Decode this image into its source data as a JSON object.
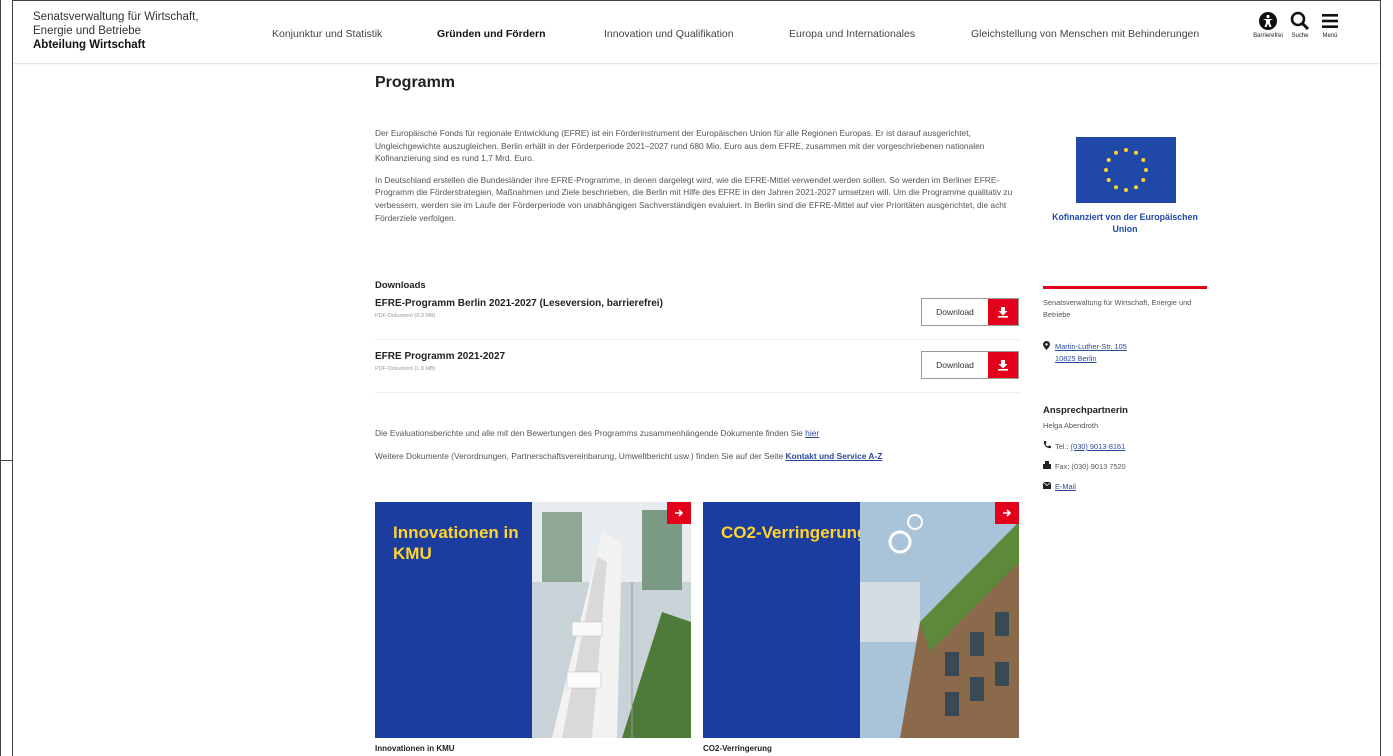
{
  "header": {
    "org_line1": "Senatsverwaltung für Wirtschaft,",
    "org_line2": "Energie und Betriebe",
    "department": "Abteilung Wirtschaft",
    "nav": [
      {
        "label": "Konjunktur und Statistik",
        "active": false
      },
      {
        "label": "Gründen und Fördern",
        "active": true
      },
      {
        "label": "Innovation und Qualifikation",
        "active": false
      },
      {
        "label": "Europa und Internationales",
        "active": false
      },
      {
        "label": "Gleichstellung von Menschen mit Behinderungen",
        "active": false
      }
    ],
    "tools": [
      {
        "label": "Barrierefrei",
        "icon": "accessibility-icon"
      },
      {
        "label": "Suche",
        "icon": "search-icon"
      },
      {
        "label": "Menü",
        "icon": "menu-icon"
      }
    ]
  },
  "main": {
    "title": "Programm",
    "intro_p1": "Der Europäische Fonds für regionale Entwicklung (EFRE) ist ein Förderinstrument der Europäischen Union für alle Regionen Europas. Er ist darauf ausgerichtet, Ungleichgewichte auszugleichen. Berlin erhält in der Förderperiode 2021–2027 rund 680 Mio. Euro aus dem EFRE, zusammen mit der vorgeschriebenen nationalen Kofinanzierung sind es rund 1,7 Mrd. Euro.",
    "intro_p2": "In Deutschland erstellen die Bundesländer ihre EFRE-Programme, in denen dargelegt wird, wie die EFRE-Mittel verwendet werden sollen. So werden im Berliner EFRE-Programm die Förderstrategien, Maßnahmen und Ziele beschrieben, die Berlin mit Hilfe des EFRE in den Jahren 2021-2027 umsetzen will. Um die Programme qualitativ zu verbessern, werden sie im Laufe der Förderperiode von unabhängigen Sachverständigen evaluiert. In Berlin sind die EFRE-Mittel auf vier Prioritäten ausgerichtet, die acht Förderziele verfolgen.",
    "downloads_title": "Downloads",
    "downloads": [
      {
        "name": "EFRE-Programm Berlin 2021-2027 (Leseversion, barrierefrei)",
        "meta": "PDF-Dokument (8,9 MB)",
        "button": "Download"
      },
      {
        "name": "EFRE Programm 2021-2027",
        "meta": "PDF-Dokument (1,9 MB)",
        "button": "Download"
      }
    ],
    "eval_text": "Die Evaluationsberichte und alle mit den Bewertungen des Programms zusammenhängende Dokumente finden Sie ",
    "eval_link": "hier",
    "more_text": "Weitere Dokumente (Verordnungen, Partnerschaftsvereinbarung, Umweltbericht usw.) finden Sie auf der Seite ",
    "more_link": "Kontakt und Service A-Z",
    "tiles": [
      {
        "text": "Innovationen in KMU",
        "caption": "Innovationen in KMU"
      },
      {
        "text": "CO2-Verringerung",
        "caption": "CO2-Verringerung"
      }
    ]
  },
  "sidebar": {
    "eu_label": "Kofinanziert von der Europäischen Union",
    "org": "Senatsverwaltung für Wirtschaft, Energie und Betriebe",
    "address_line1": "Martin-Luther-Str. 105",
    "address_line2": "10825 Berlin",
    "contact_title": "Ansprechpartnerin",
    "contact_name": "Helga Abendroth",
    "tel_label": "Tel.:",
    "tel": "(030) 9013-8161",
    "fax": "Fax: (030) 9013 7520",
    "email": "E-Mail"
  },
  "colors": {
    "accent_red": "#e2001a",
    "eu_blue": "#1f48a8",
    "tile_blue": "#1c3da0",
    "tile_yellow": "#ffd42a"
  }
}
